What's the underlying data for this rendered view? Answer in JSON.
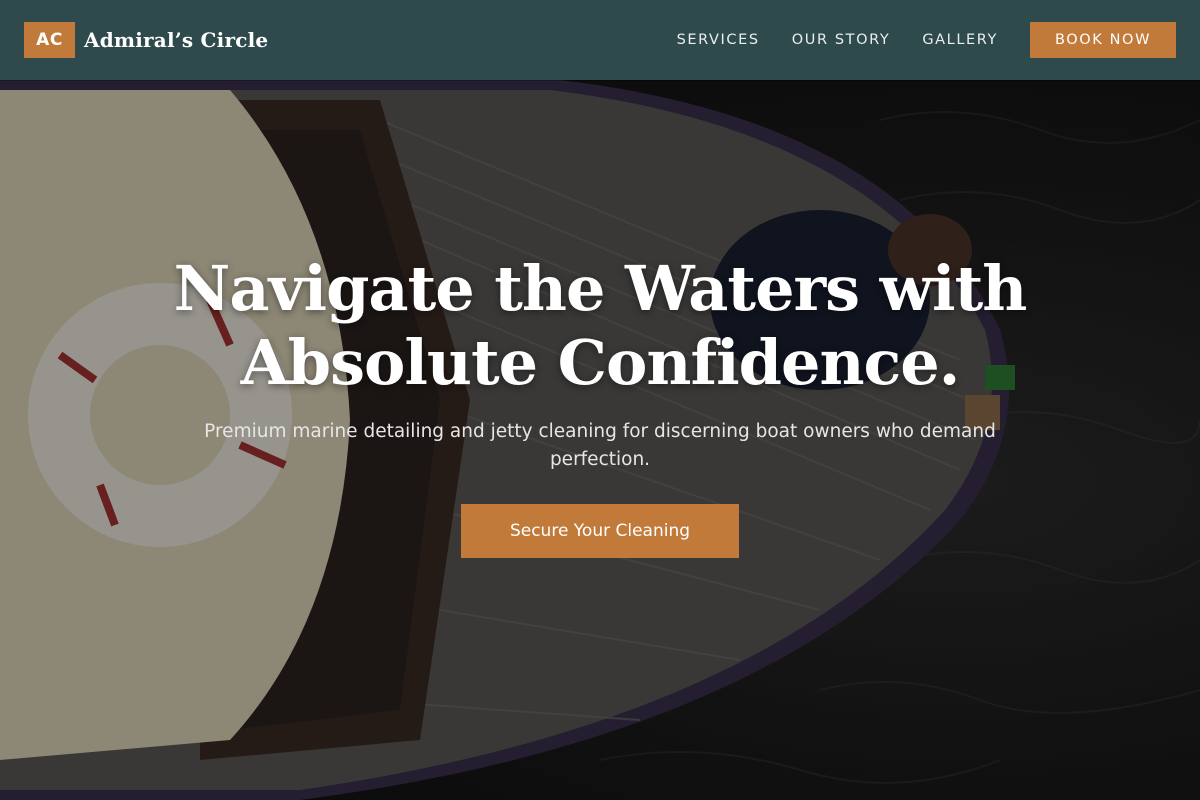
{
  "brand": {
    "badge": "AC",
    "name": "Admiral’s Circle"
  },
  "nav": {
    "items": [
      "SERVICES",
      "OUR STORY",
      "GALLERY"
    ],
    "book_label": "BOOK NOW"
  },
  "hero": {
    "headline": "Navigate the Waters with Absolute Confidence.",
    "subhead": "Premium marine detailing and jetty cleaning for discerning boat owners who demand perfection.",
    "cta_label": "Secure Your Cleaning"
  },
  "colors": {
    "header_bg": "#2e4a4c",
    "accent": "#c17a3a",
    "text": "#ffffff"
  }
}
